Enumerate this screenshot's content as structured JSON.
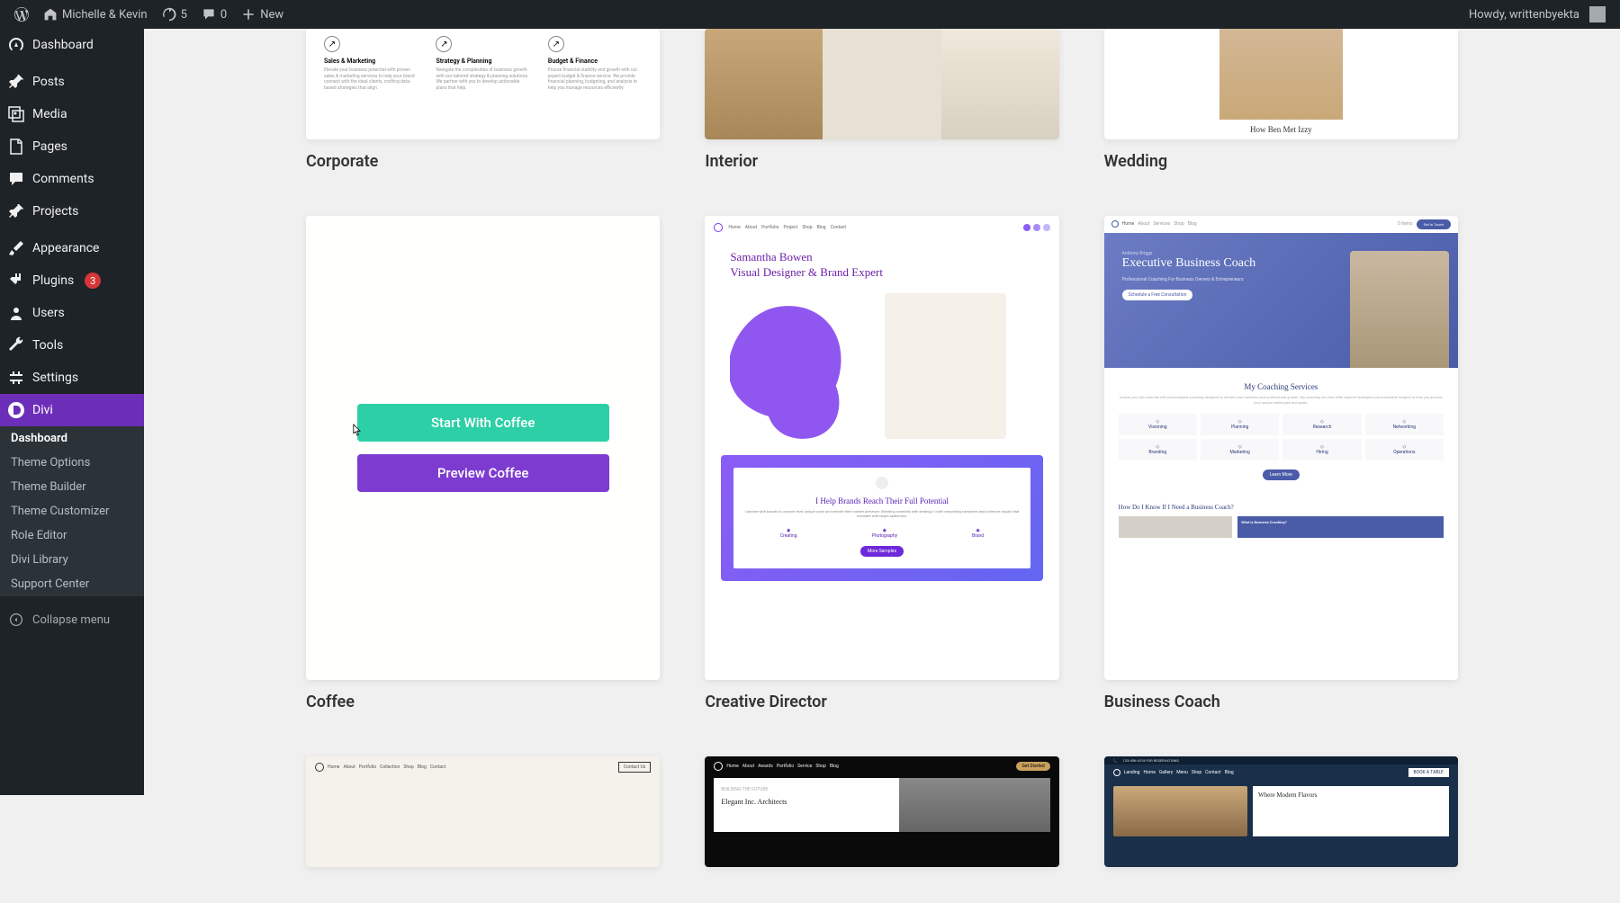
{
  "adminbar": {
    "site_name": "Michelle & Kevin",
    "refresh_count": "5",
    "comments_count": "0",
    "new_label": "New",
    "howdy": "Howdy, writtenbyekta"
  },
  "sidebar": {
    "items": [
      {
        "label": "Dashboard"
      },
      {
        "label": "Posts"
      },
      {
        "label": "Media"
      },
      {
        "label": "Pages"
      },
      {
        "label": "Comments"
      },
      {
        "label": "Projects"
      },
      {
        "label": "Appearance"
      },
      {
        "label": "Plugins",
        "badge": "3"
      },
      {
        "label": "Users"
      },
      {
        "label": "Tools"
      },
      {
        "label": "Settings"
      },
      {
        "label": "Divi"
      }
    ],
    "submenu": [
      {
        "label": "Dashboard"
      },
      {
        "label": "Theme Options"
      },
      {
        "label": "Theme Builder"
      },
      {
        "label": "Theme Customizer"
      },
      {
        "label": "Role Editor"
      },
      {
        "label": "Divi Library"
      },
      {
        "label": "Support Center"
      }
    ],
    "collapse": "Collapse menu"
  },
  "templates": {
    "row1": [
      {
        "label": "Corporate"
      },
      {
        "label": "Interior"
      },
      {
        "label": "Wedding"
      }
    ],
    "row2": [
      {
        "label": "Coffee",
        "overlay": {
          "start": "Start With Coffee",
          "preview": "Preview Coffee"
        }
      },
      {
        "label": "Creative Director"
      },
      {
        "label": "Business Coach"
      }
    ]
  },
  "thumb_content": {
    "corporate": {
      "cols": [
        {
          "title": "Sales & Marketing",
          "text": "Elevate your business potential with proven sales & marketing services to help your brand connect with the ideal clients, crafting data-based strategies that align."
        },
        {
          "title": "Strategy & Planning",
          "text": "Navigate the complexities of business growth with our tailored strategy & planning solutions. We partner with you to develop actionable plans that help."
        },
        {
          "title": "Budget & Finance",
          "text": "Ensure financial stability and growth with our expert budget & finance service. We provide financial planning, budgeting, and analysis to help you manage resources efficiently."
        }
      ]
    },
    "wedding": {
      "caption": "How Ben Met Izzy"
    },
    "creative_director": {
      "nav": [
        "Home",
        "About",
        "Portfolio",
        "Project",
        "Shop",
        "Blog",
        "Contact"
      ],
      "title": "Samantha Bowen\nVisual Designer & Brand Expert",
      "banner_title": "I Help Brands Reach Their Full Potential",
      "banner_text": "I partner with brands to uncover their unique voice and elevate their market presence. Blending creativity with strategy, I craft compelling narratives and cohesive visuals that resonate with target audiences.",
      "banner_cols": [
        "Creating",
        "Photography",
        "Brand"
      ],
      "banner_btn": "More Samples"
    },
    "business_coach": {
      "nav": [
        "Home",
        "About",
        "Services",
        "Shop",
        "Blog"
      ],
      "nav_right": "0 Items",
      "nav_btn": "Get In Touch",
      "subtitle": "Anthony Briggs",
      "title": "Executive Business Coach",
      "text": "Professional Coaching For Business Owners & Entrepreneurs",
      "hero_btn": "Schedule a Free Consultation",
      "services_title": "My Coaching Services",
      "services_text": "Unlock your full potential with personalized coaching designed to elevate your business and professional growth. My coaching services offer tailored strategies and actionable insights to help you achieve your unique challenges and goals.",
      "services": [
        "Visioning",
        "Planning",
        "Research",
        "Networking",
        "Branding",
        "Marketing",
        "Hiring",
        "Operations"
      ],
      "learn": "Learn More",
      "q": "How Do I Know If I Need a Business Coach?",
      "box2title": "What is Business Coaching?"
    },
    "architect": {
      "nav": [
        "Home",
        "About",
        "Portfolio",
        "Collection",
        "Shop",
        "Blog",
        "Contact"
      ],
      "btn": "Contact Us"
    },
    "dark": {
      "nav": [
        "Home",
        "About",
        "Awards",
        "Portfolio",
        "Service",
        "Shop",
        "Blog"
      ],
      "btn": "Get Started",
      "subtitle": "BUILDING THE FUTURE",
      "title": "Elegant Inc. Architects"
    },
    "restaurant": {
      "top": "123-456-4318 FOR RESERVATIONS",
      "nav": [
        "Landing",
        "Home",
        "Gallery",
        "Menu",
        "Shop",
        "Contact",
        "Blog"
      ],
      "btn": "BOOK A TABLE",
      "title": "Where Modern Flavors"
    }
  }
}
